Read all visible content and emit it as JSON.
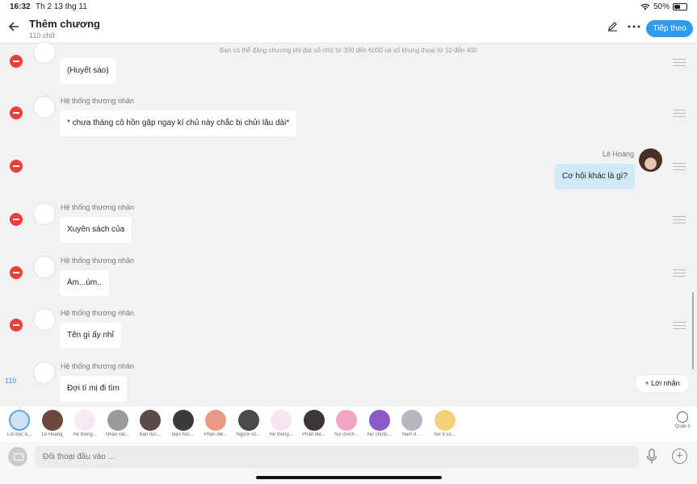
{
  "status_bar": {
    "time": "16:32",
    "date": "Th 2 13 thg 11",
    "battery": "50%"
  },
  "header": {
    "title": "Thêm chương",
    "subtitle": "110 chữ",
    "next_button": "Tiếp theo",
    "back_icon": "arrow-left-icon",
    "edit_icon": "pencil-icon",
    "more_icon": "more-icon"
  },
  "notice": "Bạn có thể đăng chương khi đạt số chữ từ 300 đến 6000 và số khung thoại từ 10 đến 400",
  "messages": [
    {
      "sender": "",
      "text": "(Huyết sáo)"
    },
    {
      "sender": "Hệ thống thương nhân",
      "text": "* chưa tháng cô hồn gặp ngay kí chủ này chắc bị chửi lâu dài*"
    },
    {
      "sender": "Lê Hoàng",
      "text": "Cơ hội khác là gì?"
    },
    {
      "sender": "Hệ thống thương nhân",
      "text": "Xuyên sách của"
    },
    {
      "sender": "Hệ thống thương nhân",
      "text": "Àm...ùm.."
    },
    {
      "sender": "Hệ thống thương nhân",
      "text": "Tên gì ấy nhỉ"
    },
    {
      "sender": "Hệ thống thương nhân",
      "text": "Đợi tí mị đi tìm"
    }
  ],
  "word_count": "110",
  "add_message_button": "+ Lời nhắn",
  "characters": [
    {
      "label": "Lời bộc b...",
      "color": "#cfe3f2"
    },
    {
      "label": "Lê Hoàng",
      "color": "#6b4a3e"
    },
    {
      "label": "Hệ thống...",
      "color": "#f5e9f4"
    },
    {
      "label": "Nhân vật...",
      "color": "#9a9a9a"
    },
    {
      "label": "Bạn học...",
      "color": "#5c4a46"
    },
    {
      "label": "Bạn học...",
      "color": "#3a3a3a"
    },
    {
      "label": "Phản diệ...",
      "color": "#e89a86"
    },
    {
      "label": "Người số...",
      "color": "#4a4a4a"
    },
    {
      "label": "Hệ thống...",
      "color": "#f7e6f2"
    },
    {
      "label": "Phản diệ...",
      "color": "#3e3538"
    },
    {
      "label": "Nữ chính...",
      "color": "#f0a6c4"
    },
    {
      "label": "Nữ chính...",
      "color": "#8a5ac8"
    },
    {
      "label": "Nam 8 ...",
      "color": "#b9b5c0"
    },
    {
      "label": "Nữ 9 số...",
      "color": "#f3d07a"
    }
  ],
  "manage_label": "Quản lí",
  "input": {
    "placeholder": "Đối thoại đầu vào ..."
  }
}
